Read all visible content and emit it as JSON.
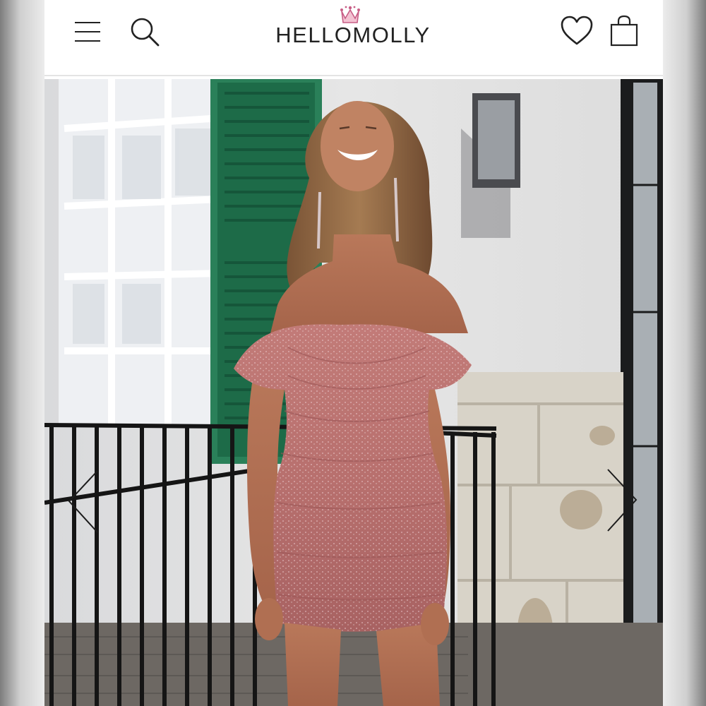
{
  "brand": {
    "name": "HELLOMOLLY",
    "accent": "#e58aa8"
  },
  "header": {
    "menu_icon": "hamburger-menu-icon",
    "search_icon": "search-icon",
    "wishlist_icon": "heart-icon",
    "bag_icon": "shopping-bag-icon"
  },
  "gallery": {
    "image_description_icon": "product-photo",
    "prev_icon": "chevron-left-icon",
    "next_icon": "chevron-right-icon"
  }
}
